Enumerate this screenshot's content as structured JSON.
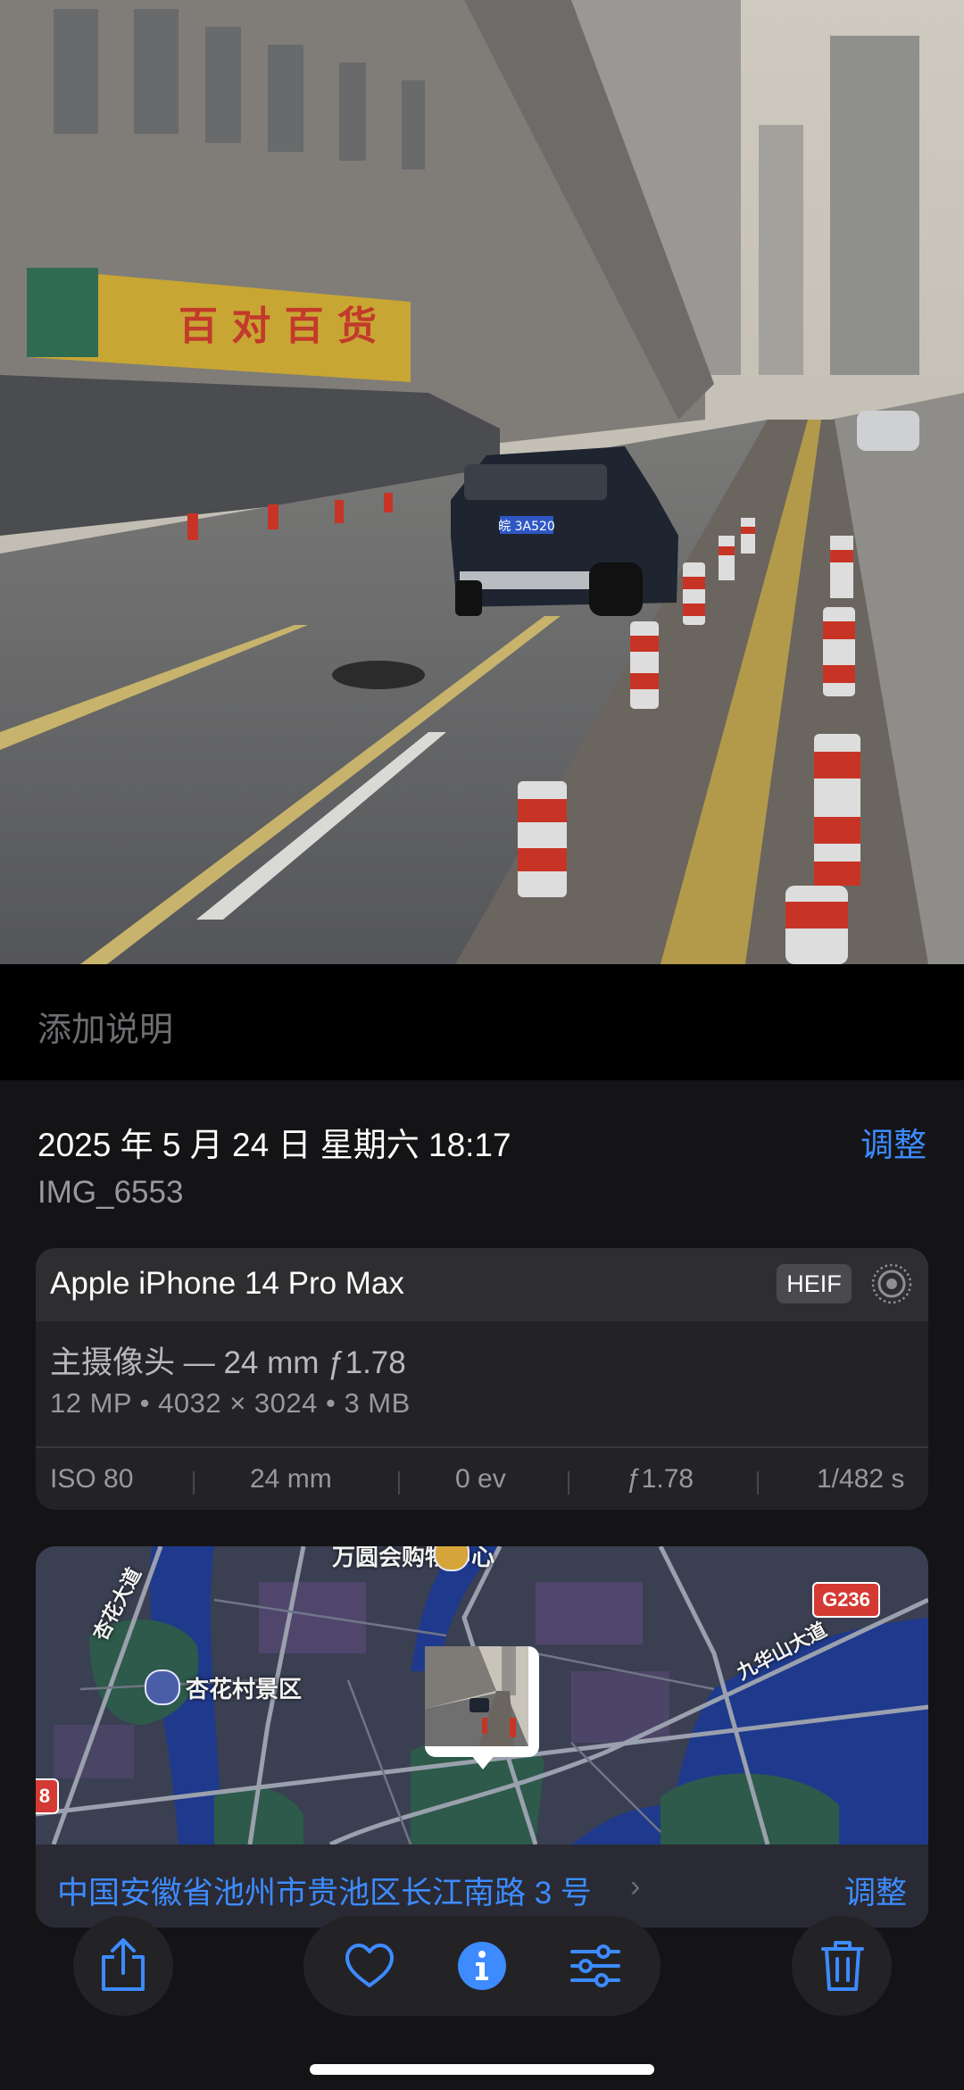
{
  "photo": {
    "plate_text": "皖 3A520"
  },
  "caption": {
    "placeholder": "添加说明"
  },
  "info": {
    "date_time": "2025 年 5 月 24 日  星期六  18:17",
    "adjust_label": "调整",
    "filename": "IMG_6553"
  },
  "camera_card": {
    "device": "Apple iPhone 14 Pro Max",
    "format_badge": "HEIF",
    "lens": "主摄像头 — 24 mm ƒ1.78",
    "specs": "12 MP • 4032 × 3024 • 3 MB",
    "exif": {
      "iso": "ISO 80",
      "focal": "24 mm",
      "ev": "0 ev",
      "aperture": "ƒ1.78",
      "shutter": "1/482 s"
    }
  },
  "map": {
    "labels": {
      "mall": "万圆会购物中心",
      "scenic": "杏花村景区",
      "avenue_left": "杏花大道",
      "avenue_right": "九华山大道"
    },
    "road_badge": "G236",
    "road_badge_partial": "8",
    "address": "中国安徽省池州市贵池区长江南路 3 号",
    "adjust_label": "调整"
  },
  "toolbar": {
    "icons": [
      "share-icon",
      "heart-icon",
      "info-icon",
      "adjust-sliders-icon",
      "trash-icon"
    ],
    "accent_color": "#3d8bff"
  }
}
